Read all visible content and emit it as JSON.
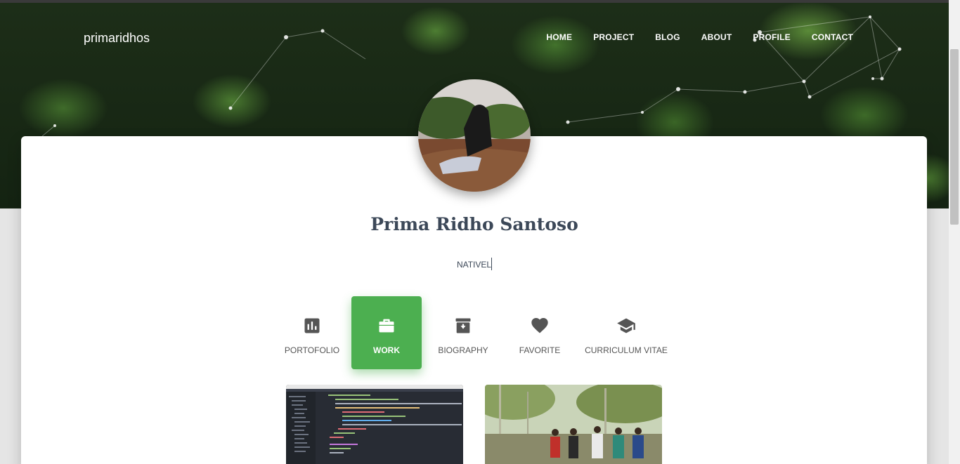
{
  "brand": "primaridhos",
  "nav": [
    "HOME",
    "PROJECT",
    "BLOG",
    "ABOUT",
    "PROFILE",
    "CONTACT"
  ],
  "profile": {
    "name": "Prima Ridho Santoso",
    "subtitle": "NATIVEL"
  },
  "tabs": [
    {
      "label": "PORTOFOLIO",
      "icon": "bar-chart-icon",
      "active": false
    },
    {
      "label": "WORK",
      "icon": "briefcase-icon",
      "active": true
    },
    {
      "label": "BIOGRAPHY",
      "icon": "archive-icon",
      "active": false
    },
    {
      "label": "FAVORITE",
      "icon": "heart-icon",
      "active": false
    },
    {
      "label": "CURRICULUM VITAE",
      "icon": "graduation-cap-icon",
      "active": false
    }
  ],
  "colors": {
    "accent": "#4caf50",
    "heading": "#3c4858"
  }
}
